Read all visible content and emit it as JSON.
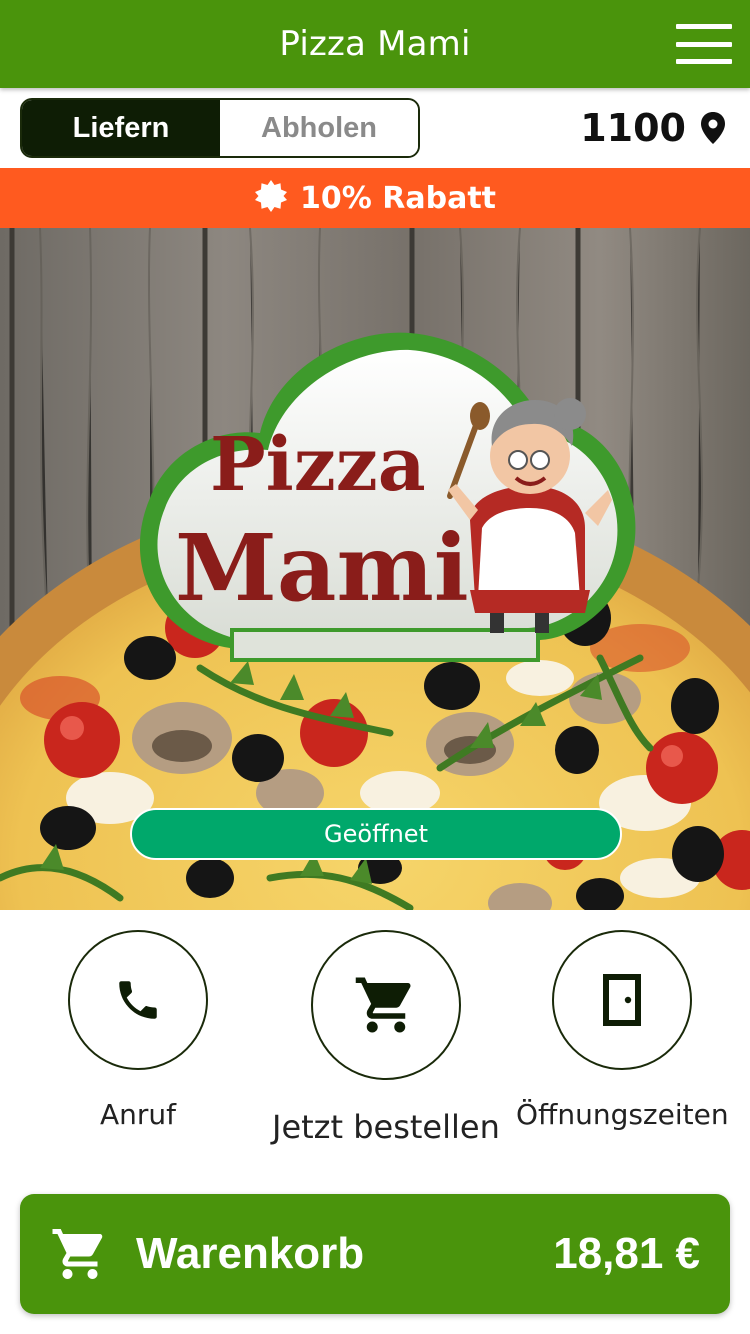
{
  "header": {
    "title": "Pizza Mami",
    "menu_icon": "hamburger-menu-icon"
  },
  "mode": {
    "options": [
      "Liefern",
      "Abholen"
    ],
    "selected": "Liefern"
  },
  "location": {
    "zip": "1100",
    "icon": "map-pin-icon"
  },
  "promo": {
    "icon": "badge-burst-icon",
    "text": "10% Rabatt"
  },
  "hero": {
    "logo_words": [
      "Pizza",
      "Mami"
    ],
    "status_label": "Geöffnet"
  },
  "actions": [
    {
      "label": "Anruf",
      "icon": "phone-icon"
    },
    {
      "label": "Jetzt bestellen",
      "icon": "cart-icon"
    },
    {
      "label": "Öffnungszeiten",
      "icon": "door-icon"
    }
  ],
  "cart": {
    "label": "Warenkorb",
    "total": "18,81 €",
    "icon": "cart-icon"
  },
  "colors": {
    "brand_green": "#4a940c",
    "promo_orange": "#ff5a1f",
    "status_green": "#00a86b",
    "dark": "#0e1d05"
  }
}
